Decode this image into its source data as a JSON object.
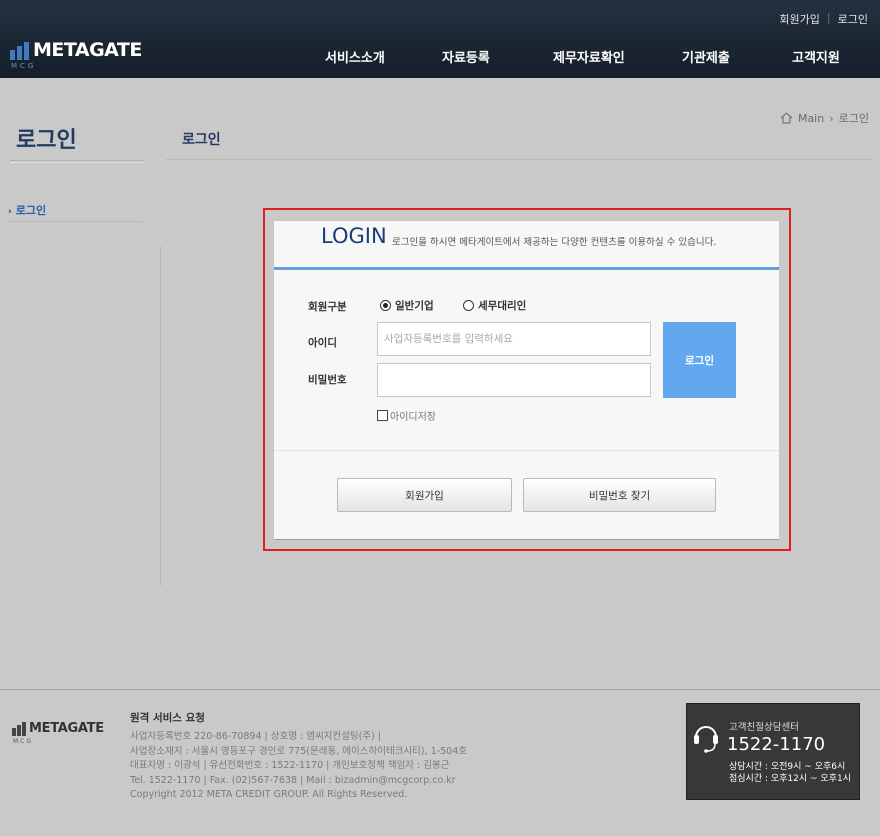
{
  "header": {
    "top_links": [
      "회원가입",
      "로그인"
    ],
    "logo_text": "METAGATE",
    "logo_sub": "MCG",
    "nav": [
      "서비스소개",
      "자료등록",
      "제무자료확인",
      "기관제출",
      "고객지원"
    ]
  },
  "sidebar": {
    "title": "로그인",
    "items": [
      "로그인"
    ]
  },
  "content": {
    "title": "로그인",
    "breadcrumb": [
      "Main",
      "로그인"
    ]
  },
  "login": {
    "title": "LOGIN",
    "description": "로그인을 하시면 메타게이트에서 제공하는 다양한 컨텐츠를 이용하실 수 있습니다.",
    "member_type_label": "회원구분",
    "member_types": [
      "일반기업",
      "세무대리인"
    ],
    "member_type_selected": "일반기업",
    "id_label": "아이디",
    "id_placeholder": "사업자등록번호를 입력하세요",
    "password_label": "비밀번호",
    "password_value": "",
    "login_button": "로그인",
    "remember_id_label": "아이디저장",
    "remember_id_checked": false,
    "signup_button": "회원가입",
    "find_password_button": "비밀번호 찾기"
  },
  "footer": {
    "logo_text": "METAGATE",
    "logo_sub": "MCG",
    "heading": "원격 서비스 요청",
    "info_lines": [
      "사업자등록번호 220-86-70894  |  상호명 : 엠씨지컨설팅(주)  |",
      "사업장소재지 : 서울시 영등포구 경인로 775(문래동, 에이스하이테크시티), 1-504호",
      "대표자명 : 이광석  |  유선전화번호 : 1522-1170  |  개인보호정책 책임자 : 김봉근",
      "Tel. 1522-1170 | Fax. (02)567-7638  |  Mail : bizadmin@mcgcorp.co.kr",
      "Copyright 2012 META CREDIT GROUP. All Rights Reserved."
    ],
    "cs_center": {
      "title": "고객친절상담센터",
      "phone": "1522-1170",
      "hours_consult": "상담시간 : 오전9시 ~ 오후6시",
      "hours_lunch": "점심시간 : 오후12시 ~ 오후1시"
    }
  },
  "colors": {
    "header_bg": "#1c2633",
    "accent_blue": "#63a8ee",
    "title_navy": "#253a63",
    "highlight_red": "#e02020"
  }
}
